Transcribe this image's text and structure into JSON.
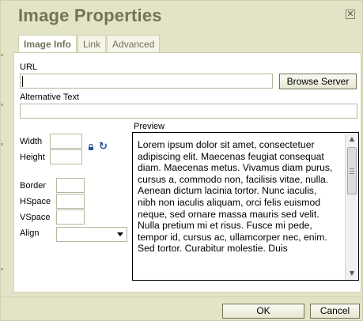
{
  "dialog": {
    "title": "Image Properties",
    "close_icon": "close-icon"
  },
  "tabs": [
    {
      "label": "Image Info",
      "active": true
    },
    {
      "label": "Link",
      "active": false
    },
    {
      "label": "Advanced",
      "active": false
    }
  ],
  "url": {
    "label": "URL",
    "value": "",
    "browse_label": "Browse Server"
  },
  "alt_text": {
    "label": "Alternative Text",
    "value": ""
  },
  "dimensions": {
    "width_label": "Width",
    "height_label": "Height",
    "width_value": "",
    "height_value": "",
    "lock_icon": "lock-icon",
    "reset_icon": "reset-size-icon"
  },
  "spacing": {
    "border_label": "Border",
    "hspace_label": "HSpace",
    "vspace_label": "VSpace",
    "align_label": "Align",
    "border_value": "",
    "hspace_value": "",
    "vspace_value": "",
    "align_value": ""
  },
  "preview": {
    "label": "Preview",
    "text": "Lorem ipsum dolor sit amet, consectetuer adipiscing elit. Maecenas feugiat consequat diam. Maecenas metus. Vivamus diam purus, cursus a, commodo non, facilisis vitae, nulla. Aenean dictum lacinia tortor. Nunc iaculis, nibh non iaculis aliquam, orci felis euismod neque, sed ornare massa mauris sed velit. Nulla pretium mi et risus. Fusce mi pede, tempor id, cursus ac, ullamcorper nec, enim. Sed tortor. Curabitur molestie. Duis"
  },
  "footer": {
    "ok_label": "OK",
    "cancel_label": "Cancel"
  },
  "colors": {
    "dialog_bg": "#e3e3c7",
    "title": "#737357",
    "border": "#d0d0b0"
  }
}
